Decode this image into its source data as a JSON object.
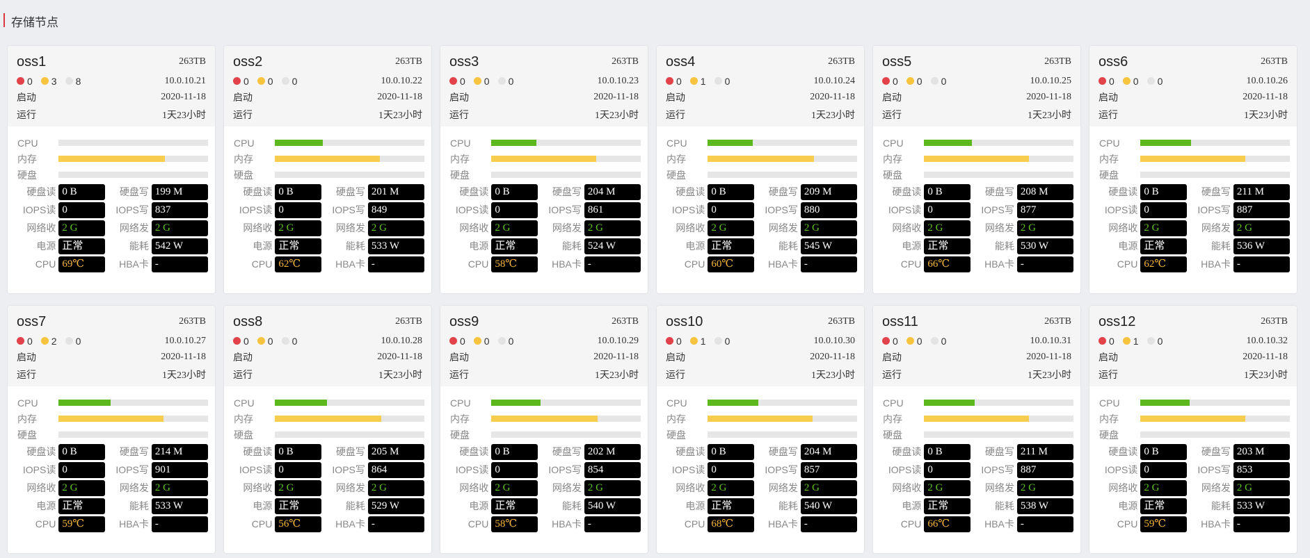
{
  "page": {
    "title": "存储节点"
  },
  "labels": {
    "start": "启动",
    "run": "运行",
    "cpu": "CPU",
    "mem": "内存",
    "disk": "硬盘",
    "disk_read": "硬盘读",
    "disk_write": "硬盘写",
    "iops_read": "IOPS读",
    "iops_write": "IOPS写",
    "net_in": "网络收",
    "net_out": "网络发",
    "power": "电源",
    "energy": "能耗",
    "cpu_temp": "CPU",
    "hba": "HBA卡"
  },
  "colors": {
    "accent": "#d9363e",
    "alert_red": "#e2434a",
    "alert_yellow": "#f6c43f",
    "alert_gray": "#e3e3e3",
    "bar_cpu": "#5cb81c",
    "bar_mem": "#f6cd4f",
    "value_green": "#5ec51f",
    "value_orange": "#f6b73c"
  },
  "nodes": [
    {
      "name": "oss1",
      "capacity": "263TB",
      "alerts": {
        "red": "0",
        "yellow": "3",
        "gray": "8"
      },
      "ip": "10.0.10.21",
      "start": "2020-11-18",
      "uptime": "1天23小时",
      "cpu_usage": 0,
      "mem_usage": 0.71,
      "disk_usage": 0,
      "disk_read": "0 B",
      "disk_write": "199 M",
      "iops_read": "0",
      "iops_write": "837",
      "net_in": "2 G",
      "net_out": "2 G",
      "power": "正常",
      "energy": "542 W",
      "cpu_temp": "69℃",
      "hba": "-"
    },
    {
      "name": "oss2",
      "capacity": "263TB",
      "alerts": {
        "red": "0",
        "yellow": "0",
        "gray": "0"
      },
      "ip": "10.0.10.22",
      "start": "2020-11-18",
      "uptime": "1天23小时",
      "cpu_usage": 0.32,
      "mem_usage": 0.7,
      "disk_usage": 0,
      "disk_read": "0 B",
      "disk_write": "201 M",
      "iops_read": "0",
      "iops_write": "849",
      "net_in": "2 G",
      "net_out": "2 G",
      "power": "正常",
      "energy": "533 W",
      "cpu_temp": "62℃",
      "hba": "-"
    },
    {
      "name": "oss3",
      "capacity": "263TB",
      "alerts": {
        "red": "0",
        "yellow": "0",
        "gray": "0"
      },
      "ip": "10.0.10.23",
      "start": "2020-11-18",
      "uptime": "1天23小时",
      "cpu_usage": 0.3,
      "mem_usage": 0.7,
      "disk_usage": 0,
      "disk_read": "0 B",
      "disk_write": "204 M",
      "iops_read": "0",
      "iops_write": "861",
      "net_in": "2 G",
      "net_out": "2 G",
      "power": "正常",
      "energy": "524 W",
      "cpu_temp": "58℃",
      "hba": "-"
    },
    {
      "name": "oss4",
      "capacity": "263TB",
      "alerts": {
        "red": "0",
        "yellow": "1",
        "gray": "0"
      },
      "ip": "10.0.10.24",
      "start": "2020-11-18",
      "uptime": "1天23小时",
      "cpu_usage": 0.3,
      "mem_usage": 0.71,
      "disk_usage": 0,
      "disk_read": "0 B",
      "disk_write": "209 M",
      "iops_read": "0",
      "iops_write": "880",
      "net_in": "2 G",
      "net_out": "2 G",
      "power": "正常",
      "energy": "545 W",
      "cpu_temp": "60℃",
      "hba": "-"
    },
    {
      "name": "oss5",
      "capacity": "263TB",
      "alerts": {
        "red": "0",
        "yellow": "0",
        "gray": "0"
      },
      "ip": "10.0.10.25",
      "start": "2020-11-18",
      "uptime": "1天23小时",
      "cpu_usage": 0.32,
      "mem_usage": 0.7,
      "disk_usage": 0,
      "disk_read": "0 B",
      "disk_write": "208 M",
      "iops_read": "0",
      "iops_write": "877",
      "net_in": "2 G",
      "net_out": "2 G",
      "power": "正常",
      "energy": "530 W",
      "cpu_temp": "66℃",
      "hba": "-"
    },
    {
      "name": "oss6",
      "capacity": "263TB",
      "alerts": {
        "red": "0",
        "yellow": "0",
        "gray": "0"
      },
      "ip": "10.0.10.26",
      "start": "2020-11-18",
      "uptime": "1天23小时",
      "cpu_usage": 0.34,
      "mem_usage": 0.7,
      "disk_usage": 0,
      "disk_read": "0 B",
      "disk_write": "211 M",
      "iops_read": "0",
      "iops_write": "887",
      "net_in": "2 G",
      "net_out": "2 G",
      "power": "正常",
      "energy": "536 W",
      "cpu_temp": "62℃",
      "hba": "-"
    },
    {
      "name": "oss7",
      "capacity": "263TB",
      "alerts": {
        "red": "0",
        "yellow": "2",
        "gray": "0"
      },
      "ip": "10.0.10.27",
      "start": "2020-11-18",
      "uptime": "1天23小时",
      "cpu_usage": 0.35,
      "mem_usage": 0.7,
      "disk_usage": 0,
      "disk_read": "0 B",
      "disk_write": "214 M",
      "iops_read": "0",
      "iops_write": "901",
      "net_in": "2 G",
      "net_out": "2 G",
      "power": "正常",
      "energy": "533 W",
      "cpu_temp": "59℃",
      "hba": "-"
    },
    {
      "name": "oss8",
      "capacity": "263TB",
      "alerts": {
        "red": "0",
        "yellow": "0",
        "gray": "0"
      },
      "ip": "10.0.10.28",
      "start": "2020-11-18",
      "uptime": "1天23小时",
      "cpu_usage": 0.35,
      "mem_usage": 0.71,
      "disk_usage": 0,
      "disk_read": "0 B",
      "disk_write": "205 M",
      "iops_read": "0",
      "iops_write": "864",
      "net_in": "2 G",
      "net_out": "2 G",
      "power": "正常",
      "energy": "529 W",
      "cpu_temp": "56℃",
      "hba": "-"
    },
    {
      "name": "oss9",
      "capacity": "263TB",
      "alerts": {
        "red": "0",
        "yellow": "0",
        "gray": "0"
      },
      "ip": "10.0.10.29",
      "start": "2020-11-18",
      "uptime": "1天23小时",
      "cpu_usage": 0.33,
      "mem_usage": 0.71,
      "disk_usage": 0,
      "disk_read": "0 B",
      "disk_write": "202 M",
      "iops_read": "0",
      "iops_write": "854",
      "net_in": "2 G",
      "net_out": "2 G",
      "power": "正常",
      "energy": "540 W",
      "cpu_temp": "58℃",
      "hba": "-"
    },
    {
      "name": "oss10",
      "capacity": "263TB",
      "alerts": {
        "red": "0",
        "yellow": "1",
        "gray": "0"
      },
      "ip": "10.0.10.30",
      "start": "2020-11-18",
      "uptime": "1天23小时",
      "cpu_usage": 0.34,
      "mem_usage": 0.7,
      "disk_usage": 0,
      "disk_read": "0 B",
      "disk_write": "204 M",
      "iops_read": "0",
      "iops_write": "857",
      "net_in": "2 G",
      "net_out": "2 G",
      "power": "正常",
      "energy": "540 W",
      "cpu_temp": "68℃",
      "hba": "-"
    },
    {
      "name": "oss11",
      "capacity": "263TB",
      "alerts": {
        "red": "0",
        "yellow": "0",
        "gray": "0"
      },
      "ip": "10.0.10.31",
      "start": "2020-11-18",
      "uptime": "1天23小时",
      "cpu_usage": 0.34,
      "mem_usage": 0.7,
      "disk_usage": 0,
      "disk_read": "0 B",
      "disk_write": "211 M",
      "iops_read": "0",
      "iops_write": "887",
      "net_in": "2 G",
      "net_out": "2 G",
      "power": "正常",
      "energy": "538 W",
      "cpu_temp": "66℃",
      "hba": "-"
    },
    {
      "name": "oss12",
      "capacity": "263TB",
      "alerts": {
        "red": "0",
        "yellow": "1",
        "gray": "0"
      },
      "ip": "10.0.10.32",
      "start": "2020-11-18",
      "uptime": "1天23小时",
      "cpu_usage": 0.33,
      "mem_usage": 0.7,
      "disk_usage": 0,
      "disk_read": "0 B",
      "disk_write": "203 M",
      "iops_read": "0",
      "iops_write": "853",
      "net_in": "2 G",
      "net_out": "2 G",
      "power": "正常",
      "energy": "533 W",
      "cpu_temp": "59℃",
      "hba": "-"
    }
  ]
}
